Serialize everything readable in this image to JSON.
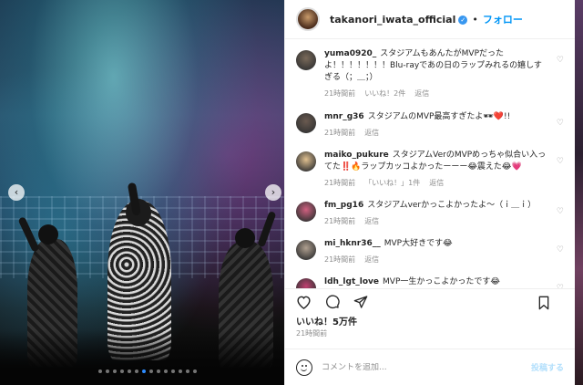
{
  "post": {
    "username": "takanori_iwata_official",
    "separator": "•",
    "follow_label": "フォロー",
    "likes": "いいね！5万件",
    "time": "21時間前"
  },
  "comments": [
    {
      "user": "yuma0920_",
      "text": "スタジアムもあんたがMVPだったよ！！！！！！！Blu-rayであの日のラップみれるの嬉しすぎる（；＿；）",
      "time": "21時間前",
      "likes": "いいね！2件",
      "reply": "返信",
      "avatar_color": "#7a6a5a"
    },
    {
      "user": "mnr_g36",
      "text": "スタジアムのMVP最高すぎたよ🕶❤️!!",
      "time": "21時間前",
      "likes": "",
      "reply": "返信",
      "avatar_color": "#6a5a50"
    },
    {
      "user": "maiko_pukure",
      "text": "スタジアムVerのMVPめっちゃ似合い入ってた‼️🔥ラップカッコよかったーーー😂震えた😂💗",
      "time": "21時間前",
      "likes": "「いいね！」1件",
      "reply": "返信",
      "avatar_color": "#e0c090"
    },
    {
      "user": "fm_pg16",
      "text": "スタジアムverかっこよかったよ〜（ｉ＿ｉ）",
      "time": "21時間前",
      "likes": "",
      "reply": "返信",
      "avatar_color": "#d06080"
    },
    {
      "user": "mi_hknr36__",
      "text": "MVP大好きです😂",
      "time": "21時間前",
      "likes": "",
      "reply": "返信",
      "avatar_color": "#b0a090"
    },
    {
      "user": "ldh_lgt_love",
      "text": "MVP一生かっこよかったです😂",
      "time": "",
      "likes": "",
      "reply": "",
      "avatar_color": "#c04070"
    }
  ],
  "add_comment": {
    "placeholder": "コメントを追加...",
    "post_label": "投稿する"
  },
  "icons": {
    "heart": "heart-icon",
    "comment": "comment-icon",
    "share": "share-icon",
    "bookmark": "bookmark-icon",
    "emoji": "emoji-icon",
    "prev": "chevron-left-icon",
    "next": "chevron-right-icon"
  },
  "carousel": {
    "count": 14,
    "active_index": 6
  },
  "colors": {
    "accent": "#0095f6",
    "verified": "#3897f0",
    "active_dot": "#2d8cff"
  }
}
